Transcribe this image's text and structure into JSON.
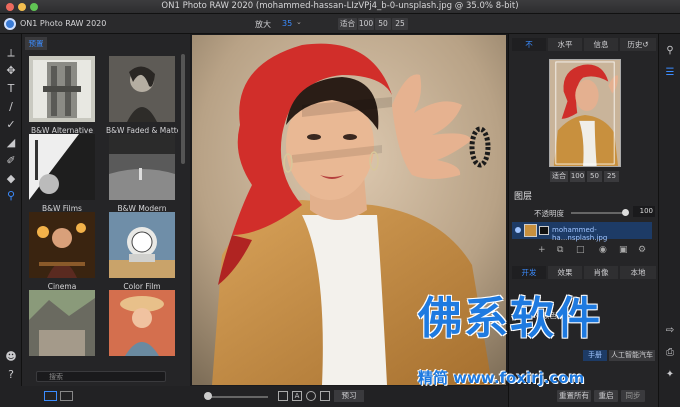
{
  "window": {
    "title": "ON1 Photo RAW 2020 (mohammed-hassan-LIzVPj4_b-0-unsplash.jpg @ 35.0% 8-bit)"
  },
  "app": {
    "name": "ON1 Photo RAW 2020"
  },
  "zoom": {
    "label": "放大",
    "value": "35",
    "buttons": [
      "适合",
      "100",
      "50",
      "25"
    ]
  },
  "browser": {
    "tab_label": "预置",
    "presets": [
      {
        "label": "B&W Alternative"
      },
      {
        "label": "B&W Faded & Matte"
      },
      {
        "label": "B&W Films"
      },
      {
        "label": "B&W Modern"
      },
      {
        "label": "Cinema"
      },
      {
        "label": "Color Film"
      }
    ],
    "search_placeholder": "搜索"
  },
  "right_panel": {
    "tabs": [
      "不",
      "水平",
      "信息",
      "历史"
    ],
    "nav_buttons": [
      "适合",
      "100",
      "50",
      "25"
    ],
    "layers_title": "图层",
    "opacity_label": "不透明度",
    "opacity_value": "100",
    "layer_name": "mohammed-ha...nsplash.jpg",
    "mode_tabs": [
      "开发",
      "效果",
      "肖像",
      "本地"
    ],
    "section_label": "色调&&颜色",
    "preset_mode": "手册",
    "preset_ai": "人工智能汽车"
  },
  "bottom": {
    "preview_label": "预习",
    "reset_all": "重置所有",
    "reset": "重启",
    "sync": "同步"
  },
  "watermark": {
    "text": "佛系软件",
    "sub": "精简 www.foxirj.com"
  },
  "colors": {
    "accent": "#3b8cff",
    "watermark": "#1e7ae0"
  }
}
